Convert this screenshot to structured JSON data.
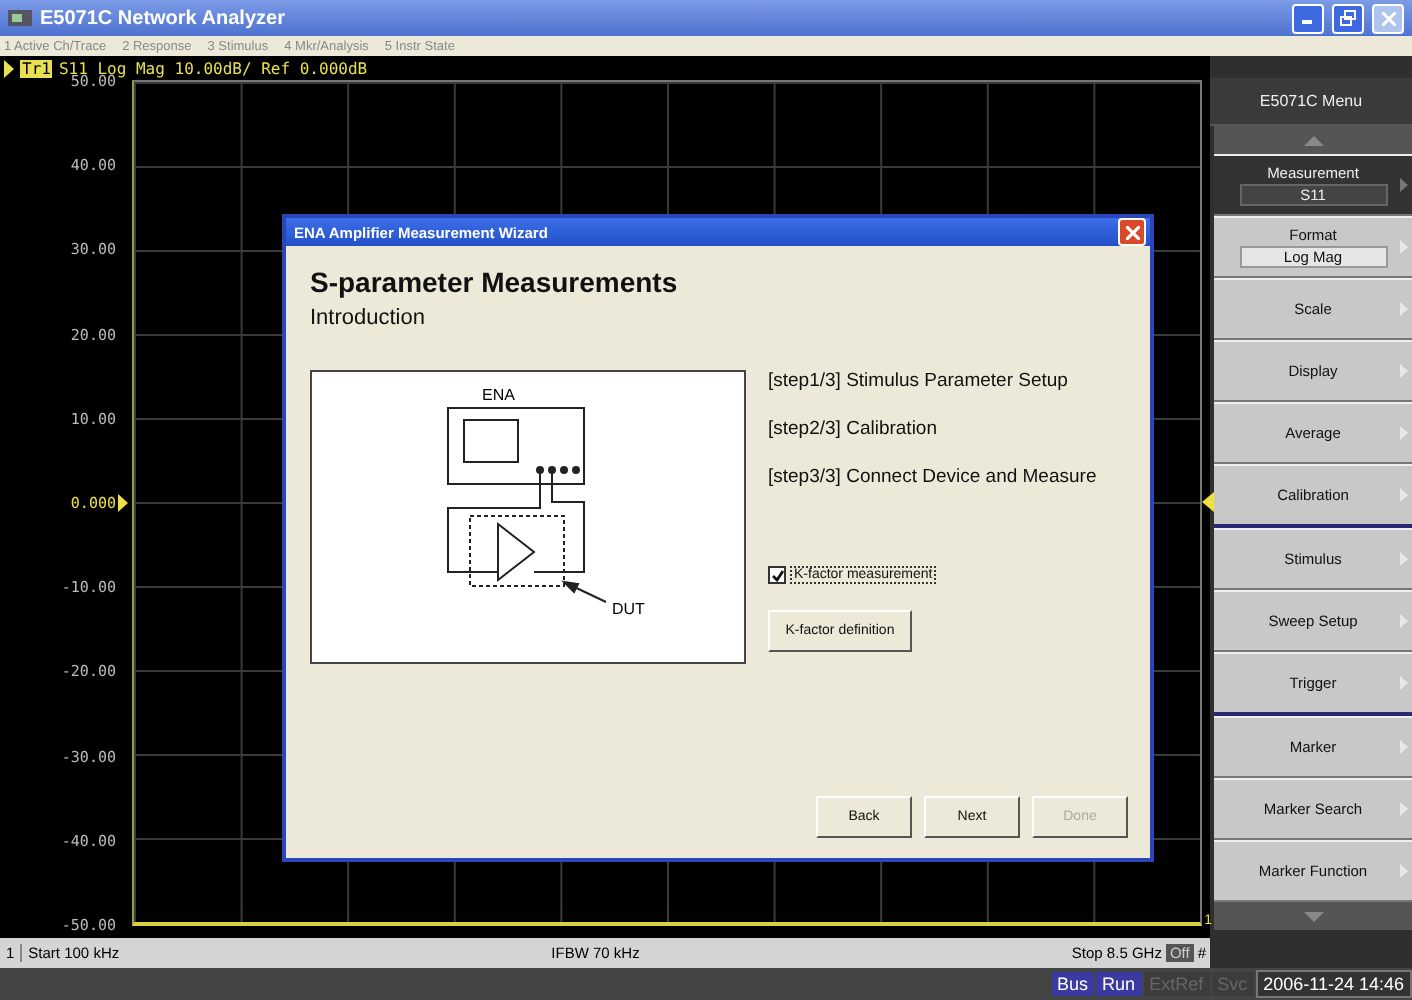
{
  "window": {
    "title": "E5071C Network Analyzer"
  },
  "menu_bar": [
    "1 Active Ch/Trace",
    "2 Response",
    "3 Stimulus",
    "4 Mkr/Analysis",
    "5 Instr State"
  ],
  "trace_header": {
    "trace": "Tr1",
    "text": "S11 Log Mag 10.00dB/ Ref 0.000dB"
  },
  "y_axis": [
    {
      "label": "50.00",
      "reference": false
    },
    {
      "label": "40.00",
      "reference": false
    },
    {
      "label": "30.00",
      "reference": false
    },
    {
      "label": "20.00",
      "reference": false
    },
    {
      "label": "10.00",
      "reference": false
    },
    {
      "label": "0.000",
      "reference": true
    },
    {
      "label": "-10.00",
      "reference": false
    },
    {
      "label": "-20.00",
      "reference": false
    },
    {
      "label": "-30.00",
      "reference": false
    },
    {
      "label": "-40.00",
      "reference": false
    },
    {
      "label": "-50.00",
      "reference": false
    }
  ],
  "marker_label": "1",
  "channel_bar": {
    "channel": "1",
    "start": "Start 100 kHz",
    "ifbw": "IFBW 70 kHz",
    "stop": "Stop 8.5 GHz",
    "off": "Off",
    "hash": "#"
  },
  "softkey_menu": {
    "title": "E5071C Menu",
    "keys": [
      {
        "kind": "value",
        "label": "Measurement",
        "value": "S11",
        "selected": true,
        "separator_after": false
      },
      {
        "kind": "value",
        "label": "Format",
        "value": "Log Mag",
        "selected": false,
        "separator_after": false
      },
      {
        "kind": "plain",
        "label": "Scale",
        "selected": false,
        "separator_after": false
      },
      {
        "kind": "plain",
        "label": "Display",
        "selected": false,
        "separator_after": false
      },
      {
        "kind": "plain",
        "label": "Average",
        "selected": false,
        "separator_after": false
      },
      {
        "kind": "plain",
        "label": "Calibration",
        "selected": false,
        "separator_after": true
      },
      {
        "kind": "plain",
        "label": "Stimulus",
        "selected": false,
        "separator_after": false
      },
      {
        "kind": "plain",
        "label": "Sweep Setup",
        "selected": false,
        "separator_after": false
      },
      {
        "kind": "plain",
        "label": "Trigger",
        "selected": false,
        "separator_after": true
      },
      {
        "kind": "plain",
        "label": "Marker",
        "selected": false,
        "separator_after": false
      },
      {
        "kind": "plain",
        "label": "Marker Search",
        "selected": false,
        "separator_after": false
      },
      {
        "kind": "plain",
        "label": "Marker Function",
        "selected": false,
        "separator_after": false
      }
    ]
  },
  "dialog": {
    "title": "ENA Amplifier Measurement Wizard",
    "heading": "S-parameter Measurements",
    "subheading": "Introduction",
    "diagram": {
      "instrument": "ENA",
      "device": "DUT"
    },
    "steps": [
      "[step1/3] Stimulus Parameter Setup",
      "[step2/3] Calibration",
      "[step3/3] Connect Device and Measure"
    ],
    "checkbox": {
      "label": "K-factor measurement",
      "checked": true
    },
    "definition_button": "K-factor definition",
    "buttons": [
      {
        "label": "Back",
        "disabled": false
      },
      {
        "label": "Next",
        "disabled": false
      },
      {
        "label": "Done",
        "disabled": true
      }
    ]
  },
  "status_bar": {
    "indicators": [
      {
        "label": "Bus",
        "on": true
      },
      {
        "label": "Run",
        "on": true
      },
      {
        "label": "ExtRef",
        "on": false
      },
      {
        "label": "Svc",
        "on": false
      }
    ],
    "datetime": "2006-11-24 14:46"
  }
}
